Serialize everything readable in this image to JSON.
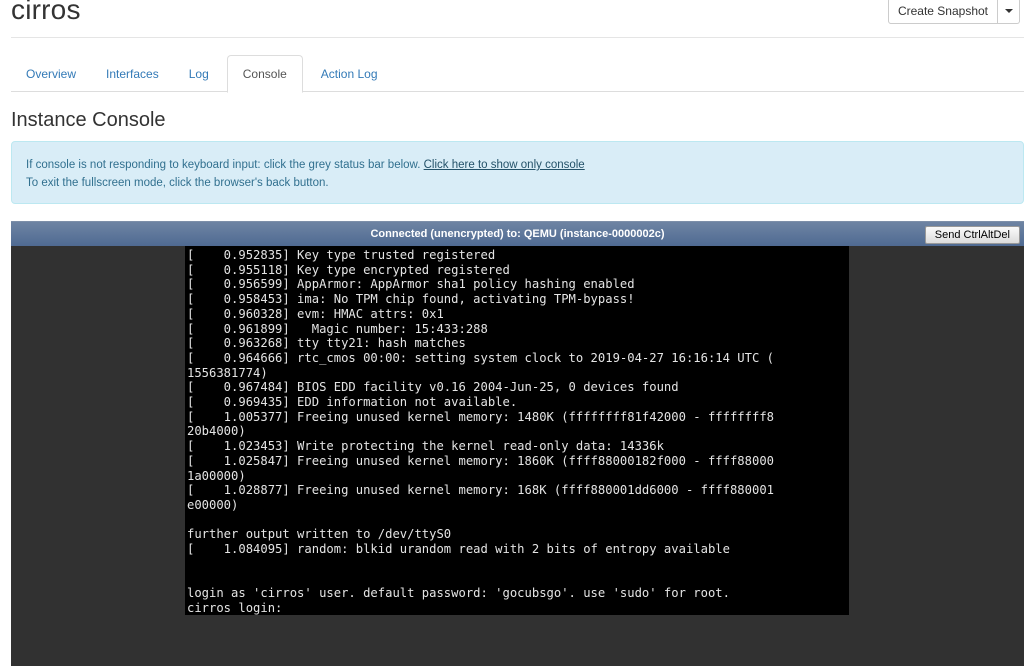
{
  "header": {
    "title": "cirros",
    "create_snapshot_label": "Create Snapshot"
  },
  "tabs": [
    {
      "label": "Overview",
      "active": false
    },
    {
      "label": "Interfaces",
      "active": false
    },
    {
      "label": "Log",
      "active": false
    },
    {
      "label": "Console",
      "active": true
    },
    {
      "label": "Action Log",
      "active": false
    }
  ],
  "section": {
    "title": "Instance Console"
  },
  "alert": {
    "line1": "If console is not responding to keyboard input: click the grey status bar below.",
    "link": "Click here to show only console",
    "line2": "To exit the fullscreen mode, click the browser's back button."
  },
  "console": {
    "status": "Connected (unencrypted) to: QEMU (instance-0000002c)",
    "ctrl_alt_del_label": "Send CtrlAltDel",
    "output": "[    0.952835] Key type trusted registered\n[    0.955118] Key type encrypted registered\n[    0.956599] AppArmor: AppArmor sha1 policy hashing enabled\n[    0.958453] ima: No TPM chip found, activating TPM-bypass!\n[    0.960328] evm: HMAC attrs: 0x1\n[    0.961899]   Magic number: 15:433:288\n[    0.963268] tty tty21: hash matches\n[    0.964666] rtc_cmos 00:00: setting system clock to 2019-04-27 16:16:14 UTC (\n1556381774)\n[    0.967484] BIOS EDD facility v0.16 2004-Jun-25, 0 devices found\n[    0.969435] EDD information not available.\n[    1.005377] Freeing unused kernel memory: 1480K (ffffffff81f42000 - ffffffff8\n20b4000)\n[    1.023453] Write protecting the kernel read-only data: 14336k\n[    1.025847] Freeing unused kernel memory: 1860K (ffff88000182f000 - ffff88000\n1a00000)\n[    1.028877] Freeing unused kernel memory: 168K (ffff880001dd6000 - ffff880001\ne00000)\n\nfurther output written to /dev/ttyS0\n[    1.084095] random: blkid urandom read with 2 bits of entropy available\n\n\nlogin as 'cirros' user. default password: 'gocubsgo'. use 'sudo' for root.\ncirros login:"
  }
}
